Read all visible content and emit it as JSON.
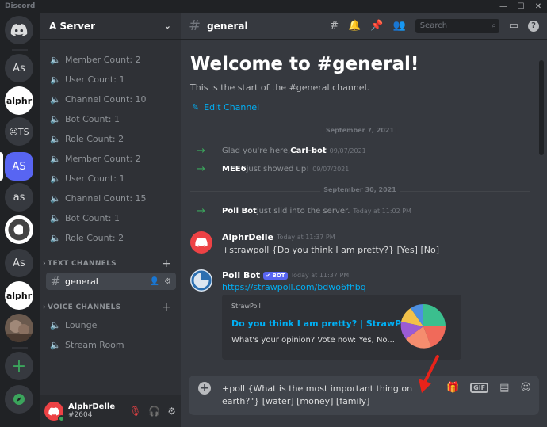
{
  "titlebar": {
    "app_name": "Discord",
    "min": "—",
    "max": "☐",
    "close": "✕"
  },
  "rail": {
    "servers": [
      {
        "label": "As"
      },
      {
        "label": "alphr"
      },
      {
        "label": "😐TS"
      },
      {
        "label": "AS"
      },
      {
        "label": "as"
      },
      {
        "label": ""
      },
      {
        "label": "As"
      },
      {
        "label": "alphr"
      },
      {
        "label": ""
      }
    ],
    "add_label": "+",
    "explore_label": "🧭"
  },
  "sidebar": {
    "server_name": "A Server",
    "stat_channels": [
      "Member Count: 2",
      "User Count: 1",
      "Channel Count: 10",
      "Bot Count: 1",
      "Role Count: 2",
      "Member Count: 2",
      "User Count: 1",
      "Channel Count: 15",
      "Bot Count: 1",
      "Role Count: 2"
    ],
    "text_category": "TEXT CHANNELS",
    "text_channels": [
      "general"
    ],
    "voice_category": "VOICE CHANNELS",
    "voice_channels": [
      "Lounge",
      "Stream Room"
    ],
    "user": {
      "name": "AlphrDelle",
      "tag": "#2604"
    }
  },
  "main": {
    "channel_name": "general",
    "search_placeholder": "Search",
    "welcome_title": "Welcome to #general!",
    "welcome_sub": "This is the start of the #general channel.",
    "edit_channel": "Edit Channel",
    "dividers": [
      "September 7, 2021",
      "September 30, 2021"
    ],
    "system_messages": [
      {
        "pre": "Glad you're here, ",
        "bold": "Carl-bot",
        "post": "",
        "ts": "09/07/2021"
      },
      {
        "pre": "",
        "bold": "MEE6",
        "post": " just showed up!",
        "ts": "09/07/2021"
      },
      {
        "pre": "",
        "bold": "Poll Bot",
        "post": " just slid into the server.",
        "ts": "Today at 11:02 PM"
      }
    ],
    "messages": [
      {
        "author": "AlphrDelle",
        "ts": "Today at 11:37 PM",
        "text": "+strawpoll {Do you think I am pretty?} [Yes] [No]"
      },
      {
        "author": "Poll Bot",
        "badge": "✔ BOT",
        "ts": "Today at 11:37 PM",
        "link": "https://strawpoll.com/bdwo6fhbq"
      }
    ],
    "embed": {
      "provider": "StrawPoll",
      "title": "Do you think I am pretty? | StrawPoll.com",
      "description": "What's your opinion? Vote now: Yes, No..."
    },
    "input_text": "+poll {What is the most important thing on earth?\"} [water] [money] [family]"
  },
  "colors": {
    "accent": "#5865f2",
    "link": "#00aff4",
    "online": "#3ba55c",
    "danger": "#ed4245"
  }
}
